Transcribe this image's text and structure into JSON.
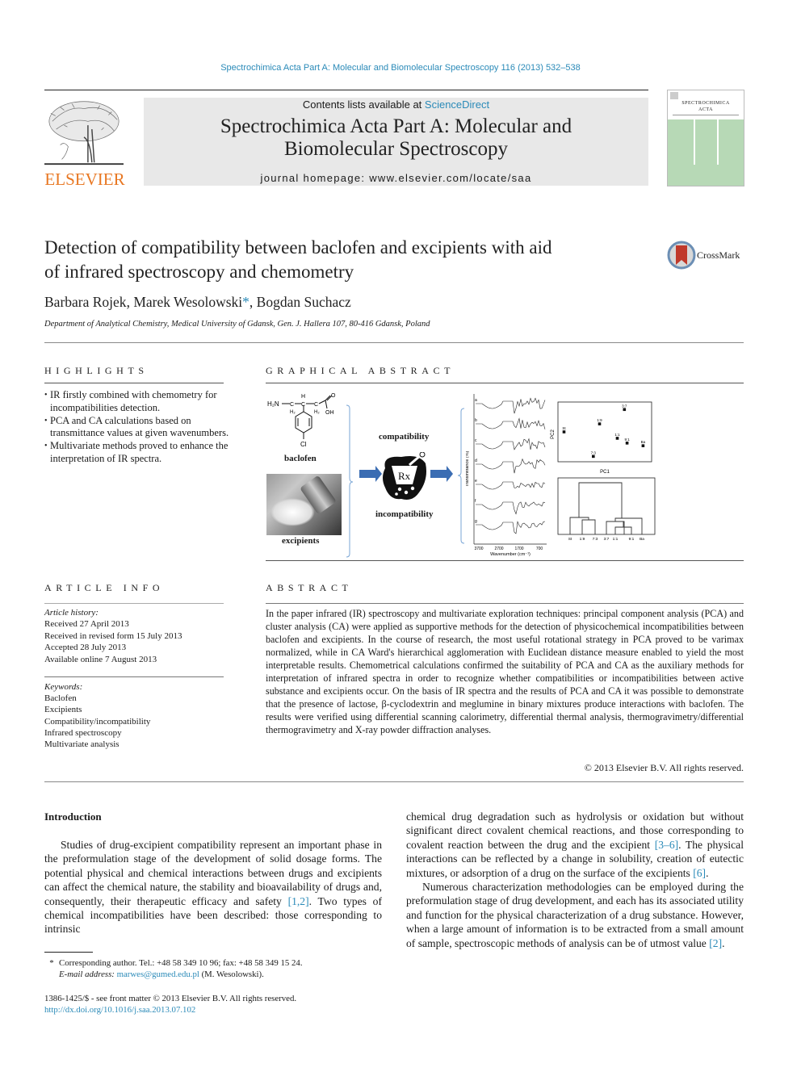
{
  "header": {
    "citation": "Spectrochimica Acta Part A: Molecular and Biomolecular Spectroscopy 116 (2013) 532–538",
    "contents_prefix": "Contents lists available at ",
    "contents_link": "ScienceDirect",
    "journal_title_line1": "Spectrochimica Acta Part A: Molecular and",
    "journal_title_line2": "Biomolecular Spectroscopy",
    "homepage_label": "journal homepage: ",
    "homepage_url": "www.elsevier.com/locate/saa",
    "publisher_logo": "ELSEVIER",
    "cover_title_line1": "SPECTROCHIMICA",
    "cover_title_line2": "ACTA"
  },
  "article": {
    "title_line1": "Detection of compatibility between baclofen and excipients with aid",
    "title_line2": "of infrared spectroscopy and chemometry",
    "crossmark": "CrossMark",
    "authors": [
      {
        "name": "Barbara Rojek",
        "sep": ", "
      },
      {
        "name": "Marek Wesolowski",
        "mark": "*",
        "sep": ", "
      },
      {
        "name": "Bogdan Suchacz",
        "sep": ""
      }
    ],
    "affiliation": "Department of Analytical Chemistry, Medical University of Gdansk, Gen. J. Hallera 107, 80-416 Gdansk, Poland"
  },
  "highlights": {
    "heading": "HIGHLIGHTS",
    "items": [
      "IR firstly combined with chemometry for incompatibilities detection.",
      "PCA and CA calculations based on transmittance values at given wavenumbers.",
      "Multivariate methods proved to enhance the interpretation of IR spectra."
    ]
  },
  "graphical_abstract": {
    "heading": "GRAPHICAL ABSTRACT",
    "labels": {
      "baclofen": "baclofen",
      "excipients": "excipients",
      "compatibility": "compatibility",
      "incompatibility": "incompatibility",
      "rx": "Rx"
    },
    "structure": {
      "nh2": "H₂N",
      "h2a": "H₂",
      "h2b": "H₂",
      "h": "H",
      "o": "O",
      "oh": "OH",
      "cl": "Cl"
    },
    "spectra": {
      "ylabel": "Transmittance (%)",
      "xlabel": "Wavenumber (cm⁻¹)",
      "xticks": [
        "3700",
        "2700",
        "1700",
        "700"
      ],
      "curve_labels": [
        "a",
        "b",
        "c",
        "d",
        "e",
        "f",
        "g"
      ]
    },
    "pca": {
      "xlabel": "PC1",
      "ylabel": "PC2",
      "points": [
        {
          "label": "St",
          "pc1": 0.05,
          "pc2": 0.5
        },
        {
          "label": "1:9",
          "pc1": 0.45,
          "pc2": 0.65
        },
        {
          "label": "3:7",
          "pc1": 0.73,
          "pc2": 0.92
        },
        {
          "label": "1:1",
          "pc1": 0.65,
          "pc2": 0.38
        },
        {
          "label": "9:1",
          "pc1": 0.76,
          "pc2": 0.29
        },
        {
          "label": "Ba",
          "pc1": 0.94,
          "pc2": 0.24
        },
        {
          "label": "7:3",
          "pc1": 0.38,
          "pc2": 0.04
        }
      ]
    },
    "dendrogram": {
      "leaves": [
        "St",
        "1:9",
        "7:3",
        "3:7",
        "1:1",
        "9:1",
        "Ba"
      ]
    }
  },
  "article_info": {
    "heading": "ARTICLE INFO",
    "history_label": "Article history:",
    "history": [
      "Received 27 April 2013",
      "Received in revised form 15 July 2013",
      "Accepted 28 July 2013",
      "Available online 7 August 2013"
    ],
    "keywords_label": "Keywords:",
    "keywords": [
      "Baclofen",
      "Excipients",
      "Compatibility/incompatibility",
      "Infrared spectroscopy",
      "Multivariate analysis"
    ]
  },
  "abstract": {
    "heading": "ABSTRACT",
    "text": "In the paper infrared (IR) spectroscopy and multivariate exploration techniques: principal component analysis (PCA) and cluster analysis (CA) were applied as supportive methods for the detection of physicochemical incompatibilities between baclofen and excipients. In the course of research, the most useful rotational strategy in PCA proved to be varimax normalized, while in CA Ward's hierarchical agglomeration with Euclidean distance measure enabled to yield the most interpretable results. Chemometrical calculations confirmed the suitability of PCA and CA as the auxiliary methods for interpretation of infrared spectra in order to recognize whether compatibilities or incompatibilities between active substance and excipients occur. On the basis of IR spectra and the results of PCA and CA it was possible to demonstrate that the presence of lactose, β-cyclodextrin and meglumine in binary mixtures produce interactions with baclofen. The results were verified using differential scanning calorimetry, differential thermal analysis, thermogravimetry/differential thermogravimetry and X-ray powder diffraction analyses.",
    "copyright": "© 2013 Elsevier B.V. All rights reserved."
  },
  "introduction": {
    "heading": "Introduction",
    "left_p1_a": "Studies of drug-excipient compatibility represent an important phase in the preformulation stage of the development of solid dosage forms. The potential physical and chemical interactions between drugs and excipients can affect the chemical nature, the stability and bioavailability of drugs and, consequently, their therapeutic efficacy and safety ",
    "left_ref1": "[1,2]",
    "left_p1_b": ". Two types of chemical incompatibilities have been described: those corresponding to intrinsic",
    "right_p1_a": "chemical drug degradation such as hydrolysis or oxidation but without significant direct covalent chemical reactions, and those corresponding to covalent reaction between the drug and the excipient ",
    "right_ref1": "[3–6]",
    "right_p1_b": ". The physical interactions can be reflected by a change in solubility, creation of eutectic mixtures, or adsorption of a drug on the surface of the excipients ",
    "right_ref2": "[6]",
    "right_p1_c": ".",
    "right_p2_a": "Numerous characterization methodologies can be employed during the preformulation stage of drug development, and each has its associated utility and function for the physical characterization of a drug substance. However, when a large amount of information is to be extracted from a small amount of sample, spectroscopic methods of analysis can be of utmost value ",
    "right_ref3": "[2]",
    "right_p2_b": "."
  },
  "footnote": {
    "mark": "*",
    "corresponding": "Corresponding author. Tel.: +48 58 349 10 96; fax: +48 58 349 15 24.",
    "email_label": "E-mail address: ",
    "email": "marwes@gumed.edu.pl",
    "email_suffix": " (M. Wesolowski)."
  },
  "front_matter": {
    "issn": "1386-1425/$ - see front matter © 2013 Elsevier B.V. All rights reserved.",
    "doi": "http://dx.doi.org/10.1016/j.saa.2013.07.102"
  },
  "colors": {
    "link": "#2a8ab8",
    "elsevier_orange": "#e87722",
    "header_bg": "#e8e8e8",
    "cover_green": "#b7d9b6",
    "arrow_blue": "#3b6db3",
    "crossmark_red": "#c0392b"
  }
}
